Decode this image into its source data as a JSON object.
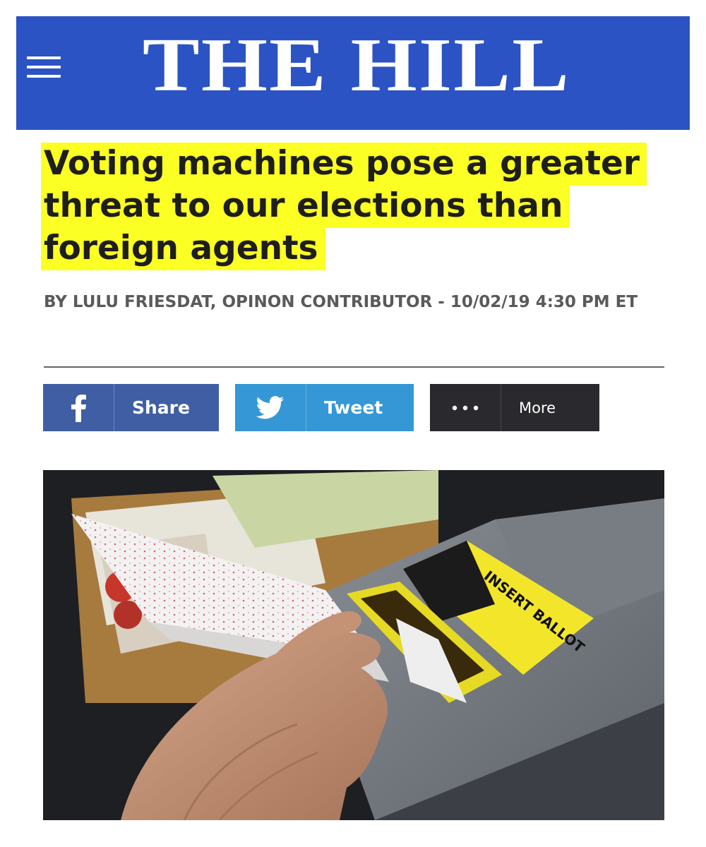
{
  "header": {
    "logo": "THE HILL",
    "background_color": "#2b53c4",
    "menu_icon": "hamburger-menu-icon"
  },
  "article": {
    "headline": "Voting machines pose a greater threat to our elections than foreign agents",
    "highlight_color": "#fbff23",
    "byline": "BY LULU FRIESDAT, OPINON CONTRIBUTOR - 10/02/19 4:30 PM ET"
  },
  "share_bar": {
    "facebook": {
      "icon": "facebook-icon",
      "label": "Share",
      "color": "#3f5ea4"
    },
    "twitter": {
      "icon": "twitter-bird-icon",
      "label": "Tweet",
      "color": "#3597d5"
    },
    "more": {
      "icon": "ellipsis-icon",
      "label": "More",
      "color": "#2a2a2e"
    }
  },
  "photo": {
    "machine_label": "INSERT BALLOT",
    "label_color": "#f3e62a"
  }
}
